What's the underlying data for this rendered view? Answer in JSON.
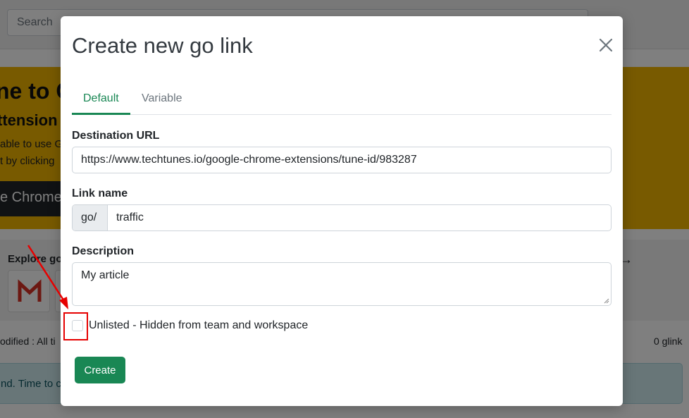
{
  "background": {
    "search_placeholder": "Search",
    "banner": {
      "heading": "ne to G",
      "subheading": "ttension",
      "line1": "able to use G",
      "line2": "t by clicking",
      "chrome_button": "e Chrome e"
    },
    "explore_label": "Explore go",
    "explore_arrow": "→",
    "modified_text": "odified : All ti",
    "count_text": "0 glink",
    "alert_text": "nd. Time to c"
  },
  "modal": {
    "title": "Create new go link",
    "tabs": [
      {
        "label": "Default",
        "active": true
      },
      {
        "label": "Variable",
        "active": false
      }
    ],
    "destination": {
      "label": "Destination URL",
      "value": "https://www.techtunes.io/google-chrome-extensions/tune-id/983287"
    },
    "link_name": {
      "label": "Link name",
      "prefix": "go/",
      "value": "traffic"
    },
    "description": {
      "label": "Description",
      "value": "My article"
    },
    "unlisted": {
      "label": "Unlisted - Hidden from team and workspace",
      "checked": false
    },
    "create_button": "Create"
  },
  "colors": {
    "accent": "#198754",
    "banner": "#f0b400",
    "annotation": "#e60000"
  }
}
